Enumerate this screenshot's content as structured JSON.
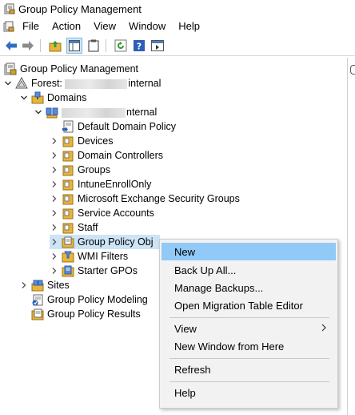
{
  "window": {
    "title": "Group Policy Management"
  },
  "menubar": {
    "items": [
      "File",
      "Action",
      "View",
      "Window",
      "Help"
    ]
  },
  "tree": {
    "root": "Group Policy Management",
    "forest_prefix": "Forest: ",
    "forest_suffix": "internal",
    "domains": "Domains",
    "domain_suffix": "nternal",
    "children": [
      "Default Domain Policy",
      "Devices",
      "Domain Controllers",
      "Groups",
      "IntuneEnrollOnly",
      "Microsoft Exchange Security Groups",
      "Service Accounts",
      "Staff",
      "Group Policy Obj",
      "WMI Filters",
      "Starter GPOs"
    ],
    "sites": "Sites",
    "modeling": "Group Policy Modeling",
    "results": "Group Policy Results"
  },
  "context_menu": {
    "items": [
      "New",
      "Back Up All...",
      "Manage Backups...",
      "Open Migration Table Editor",
      "View",
      "New Window from Here",
      "Refresh",
      "Help"
    ]
  },
  "colors": {
    "menu_highlight": "#91c9f7",
    "selection": "#cce4f7",
    "folder": "#e8b53a",
    "toolbar_arrow": "#2f6fbf"
  }
}
